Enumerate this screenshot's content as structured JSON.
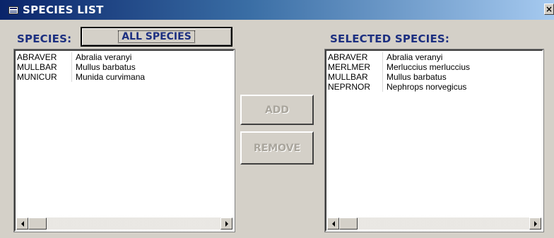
{
  "window": {
    "title": "SPECIES LIST",
    "close_glyph": "×",
    "icon": "form-icon"
  },
  "left": {
    "label": "SPECIES:",
    "all_species_button": "ALL SPECIES",
    "items": [
      {
        "code": "ABRAVER",
        "name": "Abralia veranyi"
      },
      {
        "code": "MULLBAR",
        "name": "Mullus barbatus"
      },
      {
        "code": "MUNICUR",
        "name": "Munida curvimana"
      }
    ]
  },
  "buttons": {
    "add": "ADD",
    "remove": "REMOVE"
  },
  "right": {
    "label": "SELECTED SPECIES:",
    "items": [
      {
        "code": "ABRAVER",
        "name": "Abralia veranyi"
      },
      {
        "code": "MERLMER",
        "name": "Merluccius merluccius"
      },
      {
        "code": "MULLBAR",
        "name": "Mullus barbatus"
      },
      {
        "code": "NEPRNOR",
        "name": "Nephrops norvegicus"
      }
    ]
  },
  "colors": {
    "label": "#1c2f80",
    "disabled_text": "#a9a59c",
    "titlebar_start": "#0a246a",
    "titlebar_end": "#a6caf0"
  }
}
